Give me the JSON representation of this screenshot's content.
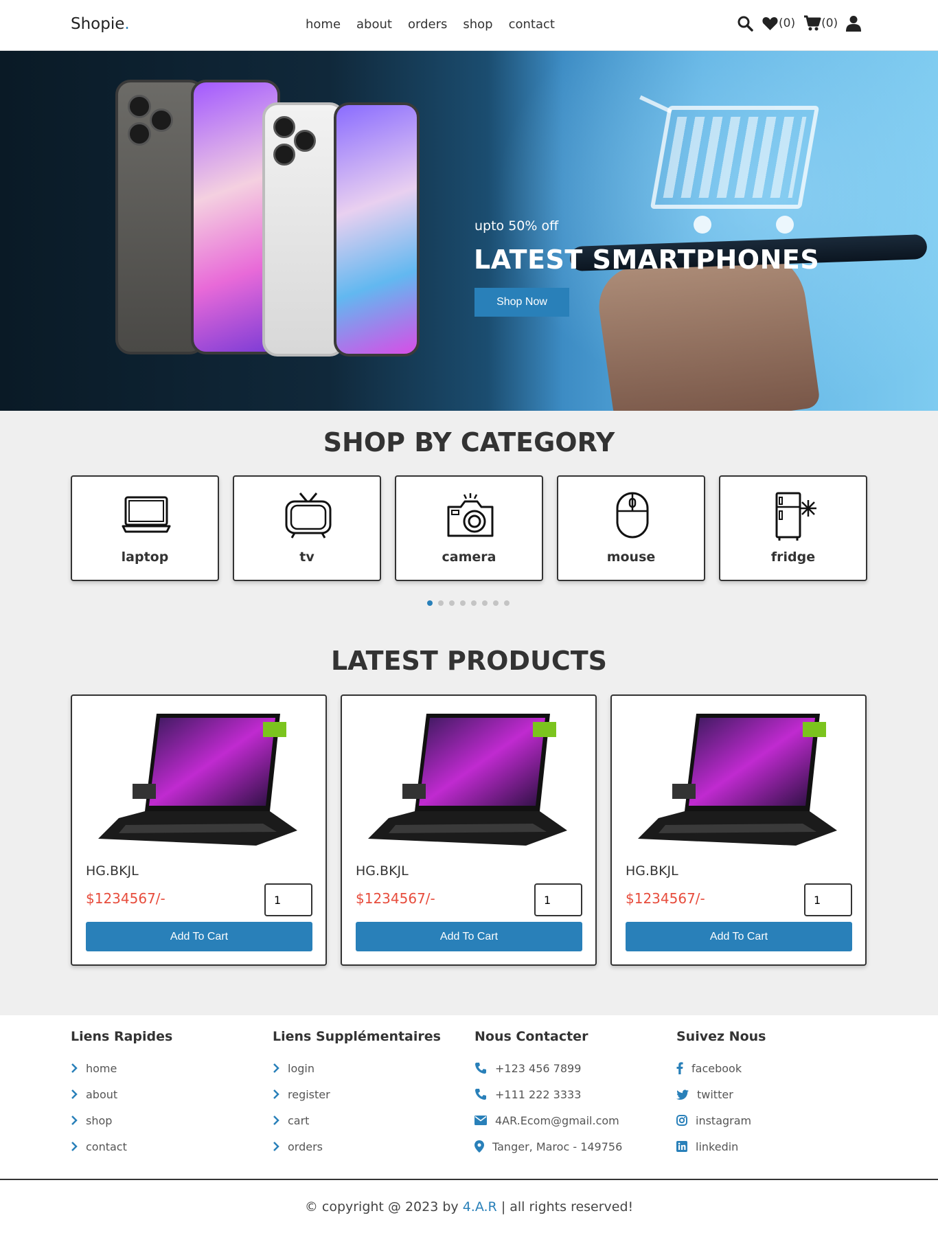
{
  "header": {
    "logo": "Shopie",
    "logo_dot": ".",
    "nav": [
      "home",
      "about",
      "orders",
      "shop",
      "contact"
    ],
    "wishlist_count": "(0)",
    "cart_count": "(0)"
  },
  "hero": {
    "subtitle": "upto 50% off",
    "title": "LATEST SMARTPHONES",
    "button": "Shop Now",
    "active_slide": 1,
    "slides": 3
  },
  "categories": {
    "title": "SHOP BY CATEGORY",
    "items": [
      {
        "label": "laptop",
        "icon": "laptop-icon"
      },
      {
        "label": "tv",
        "icon": "tv-icon"
      },
      {
        "label": "camera",
        "icon": "camera-icon"
      },
      {
        "label": "mouse",
        "icon": "mouse-icon"
      },
      {
        "label": "fridge",
        "icon": "fridge-icon"
      }
    ],
    "pagination_count": 8,
    "active_page": 1
  },
  "products": {
    "title": "LATEST PRODUCTS",
    "items": [
      {
        "name": "HG.BKJL",
        "price": "$1234567/-",
        "qty": "1",
        "button": "Add To Cart"
      },
      {
        "name": "HG.BKJL",
        "price": "$1234567/-",
        "qty": "1",
        "button": "Add To Cart"
      },
      {
        "name": "HG.BKJL",
        "price": "$1234567/-",
        "qty": "1",
        "button": "Add To Cart"
      }
    ]
  },
  "footer": {
    "quick_links": {
      "title": "Liens Rapides",
      "items": [
        "home",
        "about",
        "shop",
        "contact"
      ]
    },
    "extra_links": {
      "title": "Liens Supplémentaires",
      "items": [
        "login",
        "register",
        "cart",
        "orders"
      ]
    },
    "contact": {
      "title": "Nous Contacter",
      "items": [
        "+123 456 7899",
        "+111 222 3333",
        "4AR.Ecom@gmail.com",
        "Tanger, Maroc - 149756"
      ]
    },
    "social": {
      "title": "Suivez Nous",
      "items": [
        "facebook",
        "twitter",
        "instagram",
        "linkedin"
      ]
    },
    "credit_prefix": "© copyright @ 2023 by",
    "credit_brand": "4.A.R",
    "credit_suffix": "| all rights reserved!"
  },
  "colors": {
    "accent": "#2980b9",
    "price": "#e74c3c",
    "section_bg": "#efefef"
  }
}
